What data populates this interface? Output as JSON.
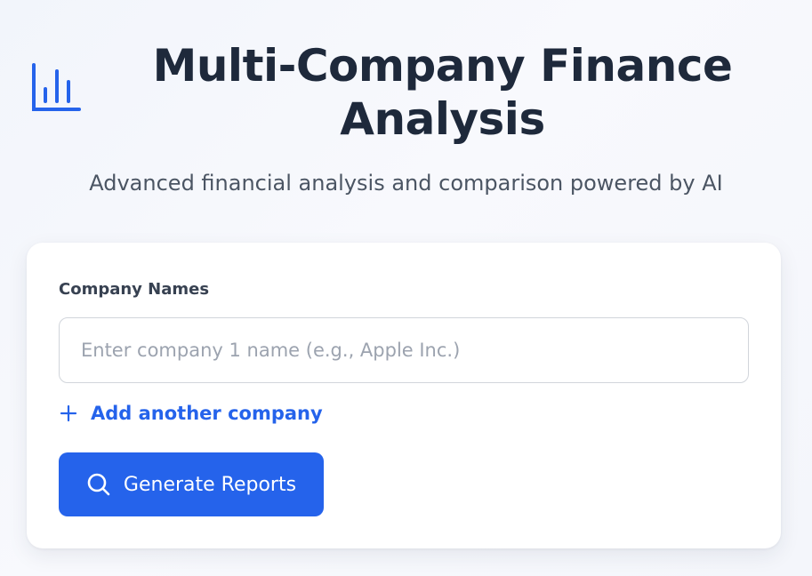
{
  "header": {
    "logo_icon": "bar-chart-icon",
    "title": "Multi-Company Finance Analysis",
    "subtitle": "Advanced financial analysis and comparison powered by AI"
  },
  "form": {
    "label": "Company Names",
    "company_input": {
      "value": "",
      "placeholder": "Enter company 1 name (e.g., Apple Inc.)"
    },
    "add_company": {
      "icon": "plus-icon",
      "label": "Add another company"
    },
    "generate_button": {
      "icon": "search-icon",
      "label": "Generate Reports"
    }
  },
  "colors": {
    "accent": "#2563eb",
    "title": "#1e293b",
    "subtitle": "#4b5563",
    "card_background": "#ffffff"
  }
}
